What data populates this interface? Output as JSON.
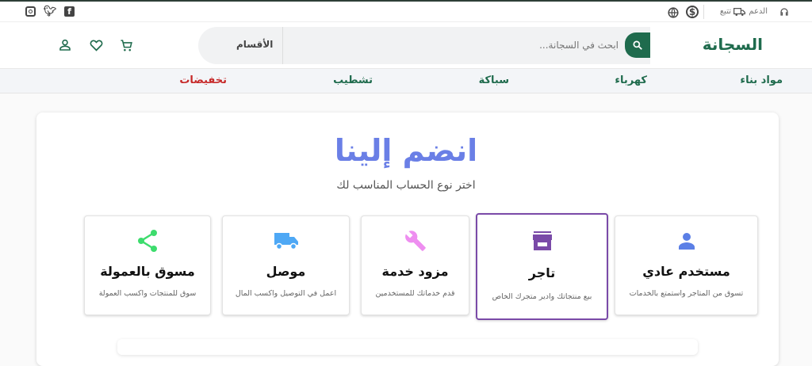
{
  "topbar": {
    "support": "الدعم",
    "track": "تتبع"
  },
  "header": {
    "logo": "السجانة",
    "search_placeholder": "ابحث في السجانة...",
    "categories": "الأقسام"
  },
  "nav": [
    "مواد بناء",
    "كهرباء",
    "سباكة",
    "تشطيب",
    "تخفيضات"
  ],
  "main": {
    "title": "انضم إلينا",
    "subtitle": "اختر نوع الحساب المناسب لك",
    "cards": [
      {
        "name": "مستخدم عادي",
        "desc": "تسوق من المتاجر واستمتع بالخدمات",
        "icon": "user-icon",
        "color": "#5b7fe6"
      },
      {
        "name": "تاجر",
        "desc": "بيع منتجاتك وادير متجرك الخاص",
        "icon": "store-icon",
        "color": "#7a4aa8",
        "selected": true
      },
      {
        "name": "مزود خدمة",
        "desc": "قدم خدماتك للمستخدمين",
        "icon": "wrench-icon",
        "color": "#ee8ef0"
      },
      {
        "name": "موصل",
        "desc": "اعمل في التوصيل واكسب المال",
        "icon": "truck-icon",
        "color": "#4ea8f5"
      },
      {
        "name": "مسوق بالعمولة",
        "desc": "سوق للمنتجات واكسب العمولة",
        "icon": "share-icon",
        "color": "#3ddc6d"
      }
    ]
  }
}
